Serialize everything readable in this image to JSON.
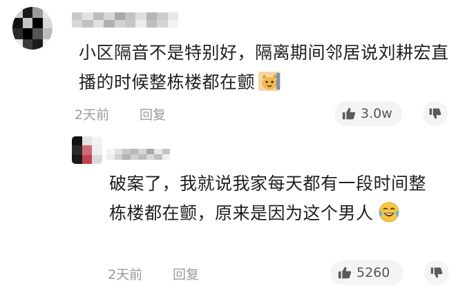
{
  "comments": [
    {
      "avatar_icon": "pixelated-avatar",
      "username_icon": "pixelated-username",
      "text": "小区隔音不是特别好，隔离期间邻居说刘耕宏直播的时候整栋楼都在颤",
      "emoji_icon": "cat-emoji-icon",
      "time": "2天前",
      "reply_label": "回复",
      "likes": "3.0w",
      "like_icon": "thumbs-up-icon",
      "dislike_icon": "thumbs-down-icon",
      "replies": [
        {
          "avatar_icon": "pixelated-avatar",
          "username_icon": "pixelated-username",
          "text": "破案了，我就说我家每天都有一段时间整栋楼都在颤，原来是因为这个男人",
          "emoji_icon": "laughing-crying-emoji-icon",
          "time": "2天前",
          "reply_label": "回复",
          "likes": "5260",
          "like_icon": "thumbs-up-icon",
          "dislike_icon": "thumbs-down-icon"
        }
      ]
    }
  ],
  "colors": {
    "text": "#1f1f1f",
    "meta": "#9a9a9a",
    "button_bg": "#f4f4f4",
    "icon": "#5a5a5a"
  }
}
